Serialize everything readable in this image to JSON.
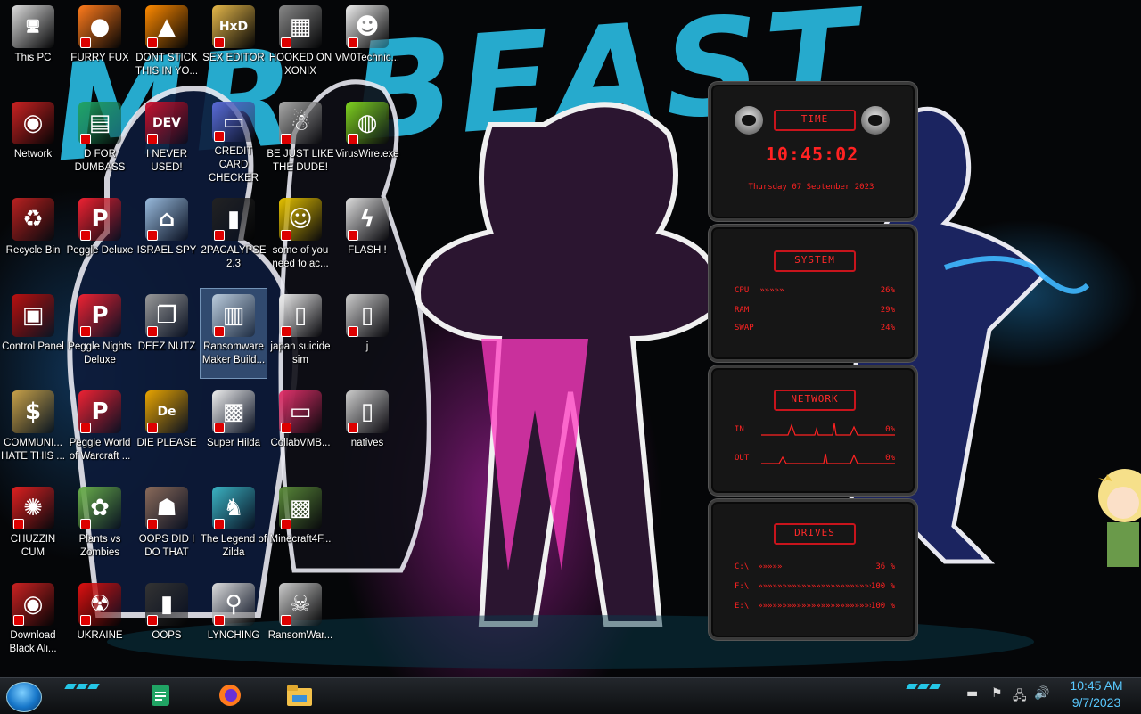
{
  "wallpaper": {
    "title": "MR BEAST",
    "accent_color": "#28b3d8",
    "glow_color": "#d628c8"
  },
  "desktop_icons": [
    {
      "label": "This PC",
      "icon": "computer-icon",
      "col": 0,
      "row": 0,
      "color": "#ddd"
    },
    {
      "label": "FURRY FUX",
      "icon": "firefox-icon",
      "col": 1,
      "row": 0,
      "color": "#ff7b1c"
    },
    {
      "label": "DONT STICK THIS IN YO...",
      "icon": "vlc-cone-icon",
      "col": 2,
      "row": 0,
      "color": "#ff8a00"
    },
    {
      "label": "SEX EDITOR",
      "icon": "hxd-icon",
      "col": 3,
      "row": 0,
      "color": "#e6b84a"
    },
    {
      "label": "HOOKED ON XONIX",
      "icon": "xonix-game-icon",
      "col": 4,
      "row": 0,
      "color": "#888"
    },
    {
      "label": "VM0Technic...",
      "icon": "doctor-icon",
      "col": 5,
      "row": 0,
      "color": "#eee"
    },
    {
      "label": "Network",
      "icon": "network-alien-icon",
      "col": 0,
      "row": 1,
      "color": "#c22"
    },
    {
      "label": "D FOR DUMBASS",
      "icon": "google-sheets-icon",
      "col": 1,
      "row": 1,
      "color": "#20a464"
    },
    {
      "label": "I NEVER USED!",
      "icon": "dev-cpp-icon",
      "col": 2,
      "row": 1,
      "color": "#c8102e"
    },
    {
      "label": "CREDIT CARD CHECKER",
      "icon": "credit-card-icon",
      "col": 3,
      "row": 1,
      "color": "#5a6bd8"
    },
    {
      "label": "BE JUST LIKE THE DUDE!",
      "icon": "santa-icon",
      "col": 4,
      "row": 1,
      "color": "#aaa"
    },
    {
      "label": "VirusWire.exe",
      "icon": "lime-icon",
      "col": 5,
      "row": 1,
      "color": "#7fd321"
    },
    {
      "label": "Recycle Bin",
      "icon": "recycle-bin-icon",
      "col": 0,
      "row": 2,
      "color": "#b22"
    },
    {
      "label": "Peggle Deluxe",
      "icon": "peggle-icon",
      "col": 1,
      "row": 2,
      "color": "#e23"
    },
    {
      "label": "ISRAEL SPY",
      "icon": "spy-network-icon",
      "col": 2,
      "row": 2,
      "color": "#9bd"
    },
    {
      "label": "2PACALYPSE 2.3",
      "icon": "terminal-icon",
      "col": 3,
      "row": 2,
      "color": "#222"
    },
    {
      "label": "some of you need to ac...",
      "icon": "beaver-icon",
      "col": 4,
      "row": 2,
      "color": "#e6c200"
    },
    {
      "label": "FLASH !",
      "icon": "flash-file-icon",
      "col": 5,
      "row": 2,
      "color": "#ddd"
    },
    {
      "label": "Control Panel",
      "icon": "control-panel-icon",
      "col": 0,
      "row": 3,
      "color": "#b11"
    },
    {
      "label": "Peggle Nights Deluxe",
      "icon": "peggle-nights-icon",
      "col": 1,
      "row": 3,
      "color": "#e23"
    },
    {
      "label": "DEEZ NUTZ",
      "icon": "stacked-windows-icon",
      "col": 2,
      "row": 3,
      "color": "#999"
    },
    {
      "label": "Ransomware Maker Build...",
      "icon": "window-app-icon",
      "col": 3,
      "row": 3,
      "color": "#bcd",
      "selected": true
    },
    {
      "label": "japan suicide sim",
      "icon": "document-icon",
      "col": 4,
      "row": 3,
      "color": "#eee"
    },
    {
      "label": "j",
      "icon": "file-icon",
      "col": 5,
      "row": 3,
      "color": "#ccc"
    },
    {
      "label": "COMMUNI... HATE THIS ...",
      "icon": "money-bag-icon",
      "col": 0,
      "row": 4,
      "color": "#c9a24a"
    },
    {
      "label": "Peggle World of Warcraft ...",
      "icon": "peggle-wow-icon",
      "col": 1,
      "row": 4,
      "color": "#e23"
    },
    {
      "label": "DIE PLEASE",
      "icon": "de-logo-icon",
      "col": 2,
      "row": 4,
      "color": "#e8a400"
    },
    {
      "label": "Super Hilda",
      "icon": "pixel-cat-icon",
      "col": 3,
      "row": 4,
      "color": "#eee"
    },
    {
      "label": "CollabVMB...",
      "icon": "monitor-icon",
      "col": 4,
      "row": 4,
      "color": "#e3316b"
    },
    {
      "label": "natives",
      "icon": "file-icon",
      "col": 5,
      "row": 4,
      "color": "#ccc"
    },
    {
      "label": "CHUZZIN CUM",
      "icon": "chuzzle-icon",
      "col": 0,
      "row": 5,
      "color": "#e02020"
    },
    {
      "label": "Plants vs Zombies",
      "icon": "pvz-icon",
      "col": 1,
      "row": 5,
      "color": "#6ab04c"
    },
    {
      "label": "OOPS DID I DO THAT",
      "icon": "portrait-icon",
      "col": 2,
      "row": 5,
      "color": "#8a6a5a"
    },
    {
      "label": "The Legend of Zilda",
      "icon": "pixel-hero-icon",
      "col": 3,
      "row": 5,
      "color": "#3bb3c3"
    },
    {
      "label": "Minecraft4F...",
      "icon": "minecraft-icon",
      "col": 4,
      "row": 5,
      "color": "#5a8a3a"
    },
    {
      "label": "Download Black Ali...",
      "icon": "alien-icon",
      "col": 0,
      "row": 6,
      "color": "#c22"
    },
    {
      "label": "UKRAINE",
      "icon": "radiation-icon",
      "col": 1,
      "row": 6,
      "color": "#d11"
    },
    {
      "label": "OOPS",
      "icon": "book-icon",
      "col": 2,
      "row": 6,
      "color": "#333"
    },
    {
      "label": "LYNCHING",
      "icon": "lynching-icon",
      "col": 3,
      "row": 6,
      "color": "#ddd"
    },
    {
      "label": "RansomWar...",
      "icon": "skull-icon",
      "col": 4,
      "row": 6,
      "color": "#ccc"
    }
  ],
  "widget": {
    "time": {
      "header": "TIME",
      "value": "10:45:02",
      "date": "Thursday 07 September 2023"
    },
    "system": {
      "header": "SYSTEM",
      "rows": [
        {
          "label": "CPU",
          "bar": "»»»»»",
          "value": "26%"
        },
        {
          "label": "RAM",
          "bar": "",
          "value": "29%"
        },
        {
          "label": "SWAP",
          "bar": "",
          "value": "24%"
        }
      ]
    },
    "network": {
      "header": "NETWORK",
      "rows": [
        {
          "label": "IN",
          "value": "0%"
        },
        {
          "label": "OUT",
          "value": "0%"
        }
      ]
    },
    "drives": {
      "header": "DRIVES",
      "rows": [
        {
          "label": "C:\\",
          "bar": "»»»»»",
          "value": "36 %"
        },
        {
          "label": "F:\\",
          "bar": "»»»»»»»»»»»»»»»»»»»»»»»»",
          "value": "100 %"
        },
        {
          "label": "E:\\",
          "bar": "»»»»»»»»»»»»»»»»»»»»»»»»",
          "value": "100 %"
        }
      ]
    }
  },
  "taskbar": {
    "pinned": [
      {
        "name": "google-sheets-icon",
        "color": "#20a464"
      },
      {
        "name": "firefox-icon",
        "color": "#ff7b1c"
      },
      {
        "name": "file-explorer-icon",
        "color": "#f3c14a"
      }
    ],
    "clock": {
      "time": "10:45 AM",
      "date": "9/7/2023"
    }
  }
}
